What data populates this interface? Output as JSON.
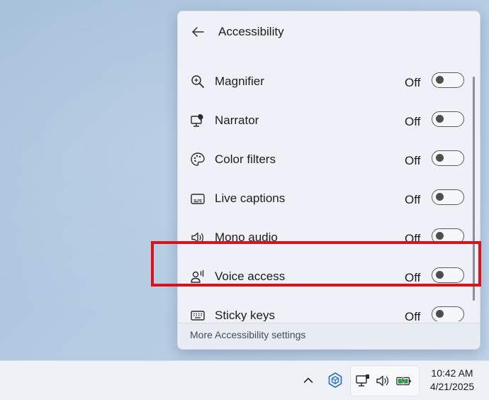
{
  "flyout": {
    "title": "Accessibility",
    "footer_link": "More Accessibility settings",
    "items": [
      {
        "label": "Magnifier",
        "state": "Off",
        "icon": "magnifier-icon"
      },
      {
        "label": "Narrator",
        "state": "Off",
        "icon": "narrator-icon"
      },
      {
        "label": "Color filters",
        "state": "Off",
        "icon": "color-filters-icon"
      },
      {
        "label": "Live captions",
        "state": "Off",
        "icon": "live-captions-icon"
      },
      {
        "label": "Mono audio",
        "state": "Off",
        "icon": "mono-audio-icon"
      },
      {
        "label": "Voice access",
        "state": "Off",
        "icon": "voice-access-icon"
      },
      {
        "label": "Sticky keys",
        "state": "Off",
        "icon": "sticky-keys-icon"
      }
    ]
  },
  "taskbar": {
    "time": "10:42 AM",
    "date": "4/21/2025",
    "tray_icons": [
      "chevron-up-icon",
      "app-tray-icon",
      "network-icon",
      "volume-icon",
      "battery-icon"
    ]
  },
  "colors": {
    "highlight": "#e0101b",
    "panel_bg": "#eef2f8"
  }
}
